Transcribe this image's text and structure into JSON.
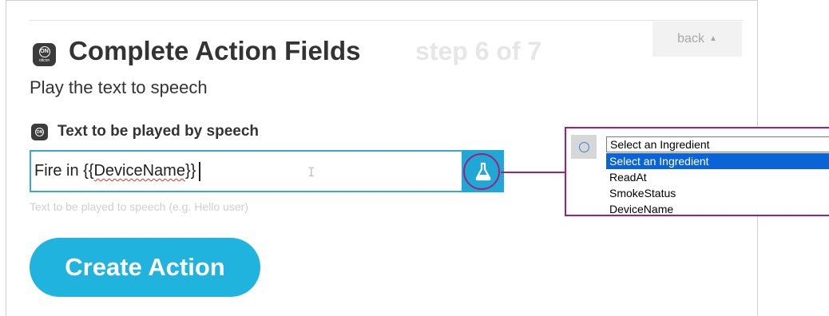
{
  "header": {
    "title": "Complete Action Fields",
    "step": "step 6 of 7",
    "back_label": "back",
    "subtitle": "Play the text to speech"
  },
  "app_icon": {
    "badge": "ON",
    "brand": "oticon"
  },
  "field": {
    "label": "Text to be played by speech",
    "value_prefix": "Fire in {{",
    "value_token": "DeviceName",
    "value_suffix": "}}",
    "helper": "Text to be played to speech (e.g. Hello user)"
  },
  "ingredient_picker": {
    "selected_value": "Select an Ingredient",
    "options": [
      "Select an Ingredient",
      "ReadAt",
      "SmokeStatus",
      "DeviceName"
    ]
  },
  "actions": {
    "create_label": "Create Action"
  },
  "colors": {
    "accent": "#1fb3dd",
    "field_border": "#3aa7d2",
    "highlight": "#a0207a",
    "dropdown_selected": "#0a64d6"
  },
  "icons": {
    "ingredient_button": "flask-icon",
    "back_caret": "caret-up-icon"
  }
}
